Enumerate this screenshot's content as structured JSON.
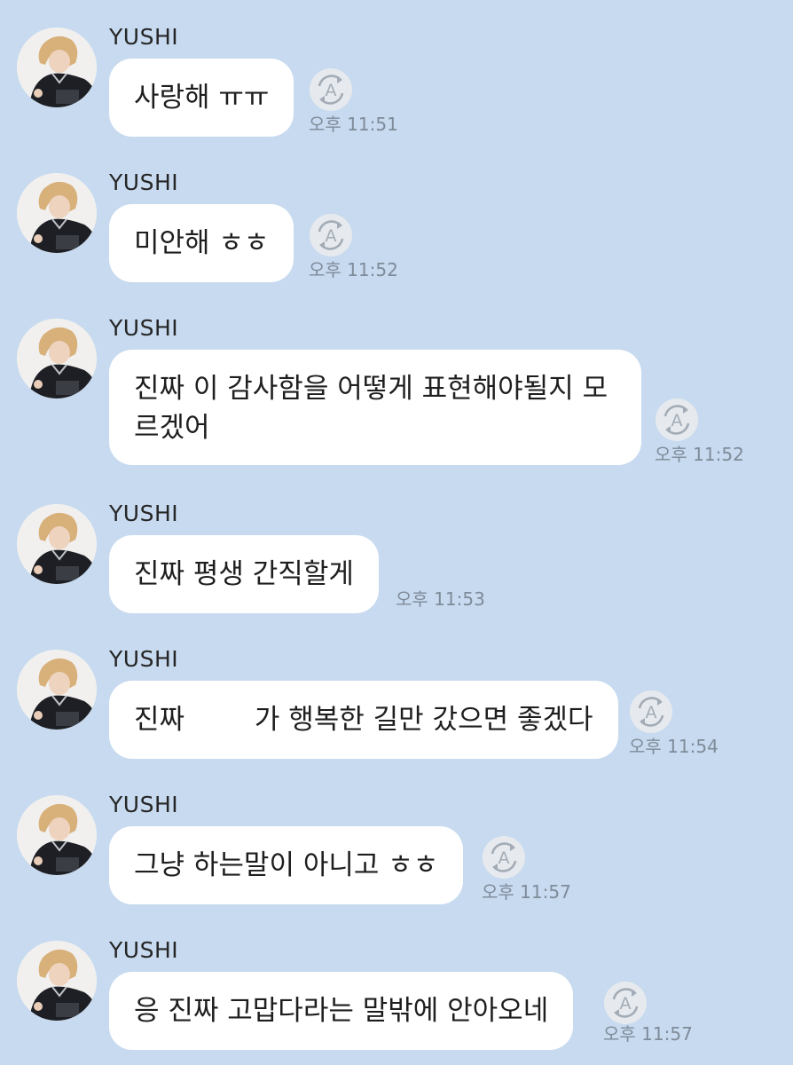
{
  "translate_glyph": "A",
  "messages": [
    {
      "sender": "YUSHI",
      "text": "사랑해 ㅠㅠ",
      "time": "오후 11:51",
      "translate_icon": "translate-icon"
    },
    {
      "sender": "YUSHI",
      "text": "미안해 ㅎㅎ",
      "time": "오후 11:52",
      "translate_icon": "translate-icon"
    },
    {
      "sender": "YUSHI",
      "text": "진짜 이 감사함을 어떻게 표현해야될지 모\n르겠어",
      "time": "오후 11:52",
      "translate_icon": "translate-icon"
    },
    {
      "sender": "YUSHI",
      "text": "진짜 평생 간직할게",
      "time": "오후 11:53",
      "translate_icon": null
    },
    {
      "sender": "YUSHI",
      "text": "진짜        가 행복한 길만 갔으면 좋겠다",
      "time": "오후 11:54",
      "translate_icon": "translate-icon"
    },
    {
      "sender": "YUSHI",
      "text": "그냥 하는말이 아니고 ㅎㅎ",
      "time": "오후 11:57",
      "translate_icon": "translate-icon"
    },
    {
      "sender": "YUSHI",
      "text": "응 진짜 고맙다라는 말밖에 안아오네",
      "time": "오후 11:57",
      "translate_icon": "translate-icon"
    }
  ]
}
